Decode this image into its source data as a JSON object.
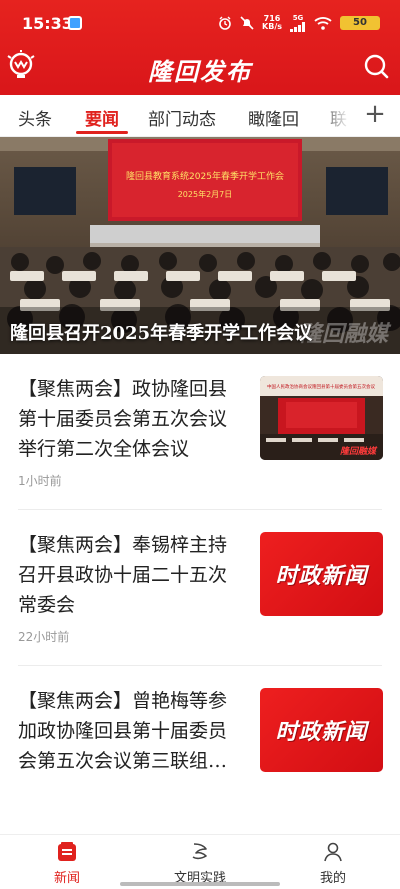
{
  "status_bar": {
    "time": "15:33",
    "net_speed_value": "716",
    "net_speed_unit": "KB/s",
    "network": "5G",
    "battery": "50"
  },
  "app_bar": {
    "title": "隆回发布",
    "logo_icon": "lightbulb-logo-icon",
    "search_icon": "search-icon"
  },
  "tabs": [
    {
      "label": "头条",
      "active": false
    },
    {
      "label": "要闻",
      "active": true
    },
    {
      "label": "部门动态",
      "active": false
    },
    {
      "label": "瞰隆回",
      "active": false
    },
    {
      "label": "联",
      "active": false
    }
  ],
  "tabs_add_label": "+",
  "hero": {
    "caption": "隆回县召开2025年春季开学工作会议",
    "banner_text": "隆回县教育系统2025年春季开学工作会",
    "banner_date": "2025年2月7日",
    "watermark": "隆回融媒"
  },
  "news": [
    {
      "headline": "【聚焦两会】政协隆回县第十届委员会第五次会议举行第二次全体会议",
      "time": "1小时前",
      "thumb_type": "photo",
      "thumb_banner": "中国人民政治协商会议隆回县第十届委员会第五次会议",
      "thumb_watermark": "隆回融媒"
    },
    {
      "headline": "【聚焦两会】奉锡梓主持召开县政协十届二十五次常委会",
      "time": "22小时前",
      "thumb_type": "text",
      "thumb_text": "时政新闻"
    },
    {
      "headline": "【聚焦两会】曾艳梅等参加政协隆回县第十届委员会第五次会议第三联组…",
      "time": "",
      "thumb_type": "text",
      "thumb_text": "时政新闻"
    }
  ],
  "bottom_nav": [
    {
      "label": "新闻",
      "icon": "news-icon",
      "active": true
    },
    {
      "label": "文明实践",
      "icon": "civilization-practice-icon",
      "active": false
    },
    {
      "label": "我的",
      "icon": "profile-icon",
      "active": false
    }
  ],
  "colors": {
    "brand_red": "#e0221e",
    "header_red": "#e6231f",
    "text_dark": "#222222",
    "text_muted": "#999999"
  }
}
